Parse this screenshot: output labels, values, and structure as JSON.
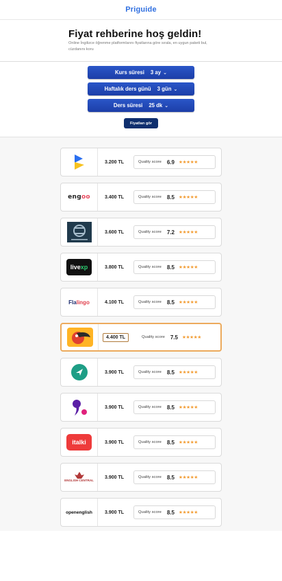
{
  "header": {
    "brand": "Priguide"
  },
  "intro": {
    "title": "Fiyat rehberine hoş geldin!",
    "subtitle": "Online İngilizce öğrenme platformlarını fiyatlarına göre sırala, en uygun paketi bul, cüzdanını koru"
  },
  "filters": [
    {
      "label": "Kurs süresi",
      "value": "3 ay"
    },
    {
      "label": "Haftalık ders günü",
      "value": "3 gün"
    },
    {
      "label": "Ders süresi",
      "value": "25 dk"
    }
  ],
  "cta_label": "Fiyatları gör",
  "score_label": "Quality score",
  "stars": "★★★★★",
  "colors": {
    "brand": "#2f6fe0",
    "pill": "#2a56c8",
    "cta": "#0f2f6e",
    "highlight": "#ecaa5c",
    "star": "#f29a2e"
  },
  "platforms": [
    {
      "logo": "bird-logo-icon",
      "price": "3.200 TL",
      "score": "6.9"
    },
    {
      "logo": "engoo-logo",
      "logo_text": "eng",
      "logo_text2": "oo",
      "price": "3.400 TL",
      "score": "8.5"
    },
    {
      "logo": "cambly-logo",
      "price": "3.600 TL",
      "score": "7.2"
    },
    {
      "logo": "livexp-logo",
      "logo_text": "live",
      "logo_text2": "xp",
      "price": "3.800 TL",
      "score": "8.5"
    },
    {
      "logo": "flalingo-logo",
      "logo_text": "Fla",
      "logo_text2": "lingo",
      "price": "4.100 TL",
      "score": "8.5"
    },
    {
      "logo": "toucan-logo-icon",
      "price": "4.400 TL",
      "score": "7.5",
      "highlight": true
    },
    {
      "logo": "preply-logo-icon",
      "price": "3.900 TL",
      "score": "8.5"
    },
    {
      "logo": "comma-logo-icon",
      "price": "3.900 TL",
      "score": "8.5"
    },
    {
      "logo": "italki-logo",
      "logo_text": "italki",
      "price": "3.900 TL",
      "score": "8.5"
    },
    {
      "logo": "english-central-logo",
      "logo_text": "ENGLISH CENTRAL",
      "price": "3.900 TL",
      "score": "8.5"
    },
    {
      "logo": "openenglish-logo",
      "logo_text": "openenglish",
      "price": "3.900 TL",
      "score": "8.5"
    }
  ]
}
